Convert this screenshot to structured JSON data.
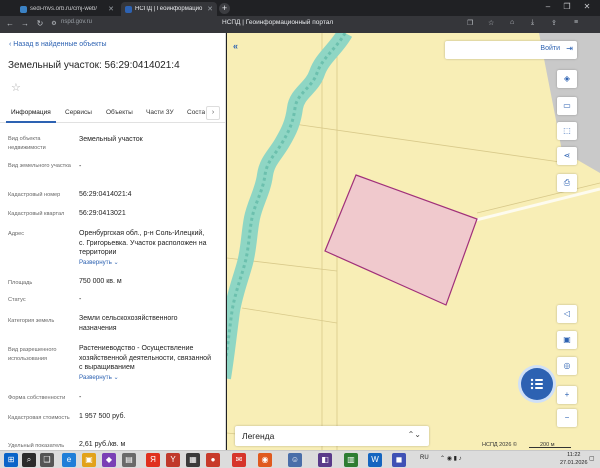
{
  "browser": {
    "tabs": [
      {
        "label": "sedi-mvs.orb.ru/cmj-web/",
        "active": false
      },
      {
        "label": "НСПД | Геоинформацио",
        "active": true
      }
    ],
    "url": "nspd.gov.ru",
    "page_title": "НСПД | Геоинформационный портал"
  },
  "panel": {
    "back_label": "Назад в найденные объекты",
    "object_title": "Земельный участок: 56:29:0414021:4",
    "tabs": [
      "Информация",
      "Сервисы",
      "Объекты",
      "Части ЗУ",
      "Состав"
    ],
    "fields": [
      {
        "label": "Вид объекта недвижимости",
        "value": "Земельный участок"
      },
      {
        "label": "Вид земельного участка",
        "value": "-"
      },
      {
        "label": "Кадастровый номер",
        "value": "56:29:0414021:4"
      },
      {
        "label": "Кадастровый квартал",
        "value": "56:29:0413021"
      },
      {
        "label": "Адрес",
        "value": "Оренбургская обл., р-н Соль-Илецкий, с. Григорьевка. Участок расположен на территории",
        "link": "Развернуть"
      },
      {
        "label": "Площадь",
        "value": "750 000 кв. м"
      },
      {
        "label": "Статус",
        "value": "-"
      },
      {
        "label": "Категория земель",
        "value": "Земли сельскохозяйственного назначения"
      },
      {
        "label": "Вид разрешенного использования",
        "value": "Растениеводство - Осуществление хозяйственной деятельности, связанной с выращиванием",
        "link": "Развернуть"
      },
      {
        "label": "Форма собственности",
        "value": "-"
      },
      {
        "label": "Кадастровая стоимость",
        "value": "1 957 500 руб."
      },
      {
        "label": "Удельный показатель",
        "value": "2,61 руб./кв. м"
      }
    ]
  },
  "map": {
    "login_label": "Войти",
    "legend_label": "Легенда",
    "copyright": "НСПД 2026 ©",
    "scale": "200 м",
    "colors": {
      "background": "#f8eeb6",
      "parcel_fill": "#f0c9cd",
      "parcel_stroke": "#a0307a",
      "river": "#8fd6c4",
      "grey_area": "#c9c9c9"
    }
  },
  "taskbar": {
    "lang": "RU",
    "time": "11:22",
    "date": "27.01.2026"
  }
}
